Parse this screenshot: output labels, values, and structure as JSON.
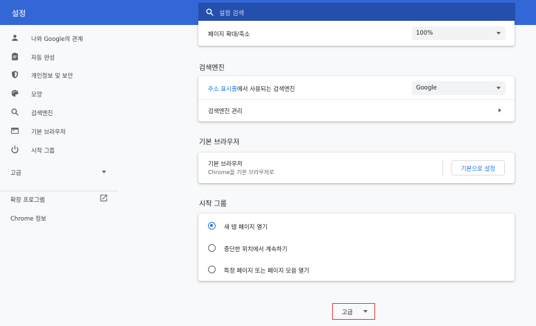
{
  "header": {
    "title": "설정",
    "search_placeholder": "설정 검색"
  },
  "sidebar": {
    "items": [
      {
        "label": "나와 Google의 관계",
        "icon": "person-icon"
      },
      {
        "label": "자동 완성",
        "icon": "clipboard-icon"
      },
      {
        "label": "개인정보 및 보안",
        "icon": "shield-icon"
      },
      {
        "label": "모양",
        "icon": "palette-icon"
      },
      {
        "label": "검색엔진",
        "icon": "search-icon"
      },
      {
        "label": "기본 브라우저",
        "icon": "browser-icon"
      },
      {
        "label": "시작 그룹",
        "icon": "power-icon"
      }
    ],
    "advanced_label": "고급",
    "extensions_label": "확장 프로그램",
    "about_label": "Chrome 정보"
  },
  "main": {
    "zoom": {
      "label": "페이지 확대/축소",
      "value": "100%"
    },
    "search_engine": {
      "title": "검색엔진",
      "address_bar_link": "주소 표시줄",
      "address_bar_rest": "에서 사용되는 검색엔진",
      "engine_value": "Google",
      "manage_label": "검색엔진 관리"
    },
    "default_browser": {
      "title": "기본 브라우저",
      "label": "기본 브라우저",
      "sub": "Chrome을 기본 브라우저로",
      "button": "기본으로 설정"
    },
    "startup": {
      "title": "시작 그룹",
      "options": [
        {
          "label": "새 탭 페이지 열기",
          "selected": true
        },
        {
          "label": "중단한 위치에서 계속하기",
          "selected": false
        },
        {
          "label": "특정 페이지 또는 페이지 모음 열기",
          "selected": false
        }
      ]
    },
    "advanced_button": "고급"
  },
  "colors": {
    "header": "#3367d6",
    "accent": "#1a73e8",
    "highlight_border": "#e53935"
  }
}
